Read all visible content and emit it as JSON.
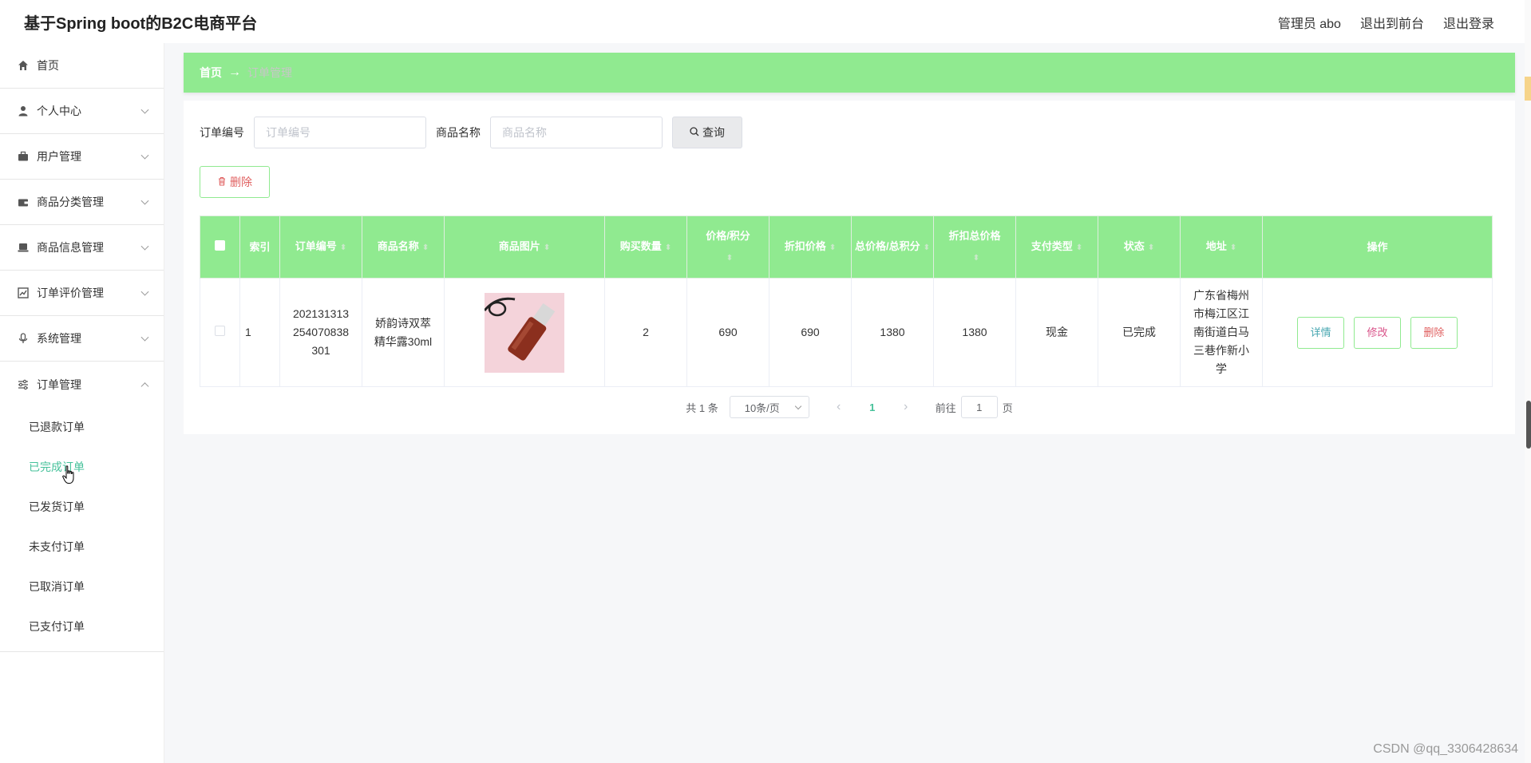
{
  "app": {
    "title": "基于Spring boot的B2C电商平台",
    "user": "管理员 abo",
    "exit_front": "退出到前台",
    "logout": "退出登录"
  },
  "sidebar": {
    "items": [
      {
        "label": "首页",
        "icon": "home-icon"
      },
      {
        "label": "个人中心",
        "icon": "user-icon"
      },
      {
        "label": "用户管理",
        "icon": "briefcase-icon"
      },
      {
        "label": "商品分类管理",
        "icon": "wallet-icon"
      },
      {
        "label": "商品信息管理",
        "icon": "laptop-icon"
      },
      {
        "label": "订单评价管理",
        "icon": "chart-icon"
      },
      {
        "label": "系统管理",
        "icon": "microphone-icon"
      },
      {
        "label": "订单管理",
        "icon": "sliders-icon"
      }
    ],
    "sub_items": [
      "已退款订单",
      "已完成订单",
      "已发货订单",
      "未支付订单",
      "已取消订单",
      "已支付订单"
    ],
    "active_sub": "已完成订单"
  },
  "breadcrumb": {
    "home": "首页",
    "current": "订单管理"
  },
  "search": {
    "order_no_label": "订单编号",
    "order_no_placeholder": "订单编号",
    "product_label": "商品名称",
    "product_placeholder": "商品名称",
    "query_button": "查询"
  },
  "delete_button": "删除",
  "table": {
    "headers": [
      "索引",
      "订单编号",
      "商品名称",
      "商品图片",
      "购买数量",
      "价格/积分",
      "折扣价格",
      "总价格/总积分",
      "折扣总价格",
      "支付类型",
      "状态",
      "地址",
      "操作"
    ],
    "rows": [
      {
        "index": "1",
        "order_no": "202131313254070838301",
        "product": "娇韵诗双萃精华露30ml",
        "qty": "2",
        "price": "690",
        "discount_price": "690",
        "total": "1380",
        "discount_total": "1380",
        "pay_type": "现金",
        "status": "已完成",
        "address": "广东省梅州市梅江区江南街道白马三巷作新小学",
        "op_detail": "详情",
        "op_edit": "修改",
        "op_delete": "删除"
      }
    ]
  },
  "pagination": {
    "total": "共 1 条",
    "page_size": "10条/页",
    "current_page": "1",
    "goto_label": "前往",
    "goto_value": "1",
    "page_suffix": "页"
  },
  "watermark": "CSDN @qq_3306428634",
  "colors": {
    "accent": "#90ea90",
    "active_text": "#46c19a",
    "danger": "#e06060",
    "edit": "#d9548a",
    "detail": "#46a6b0"
  }
}
